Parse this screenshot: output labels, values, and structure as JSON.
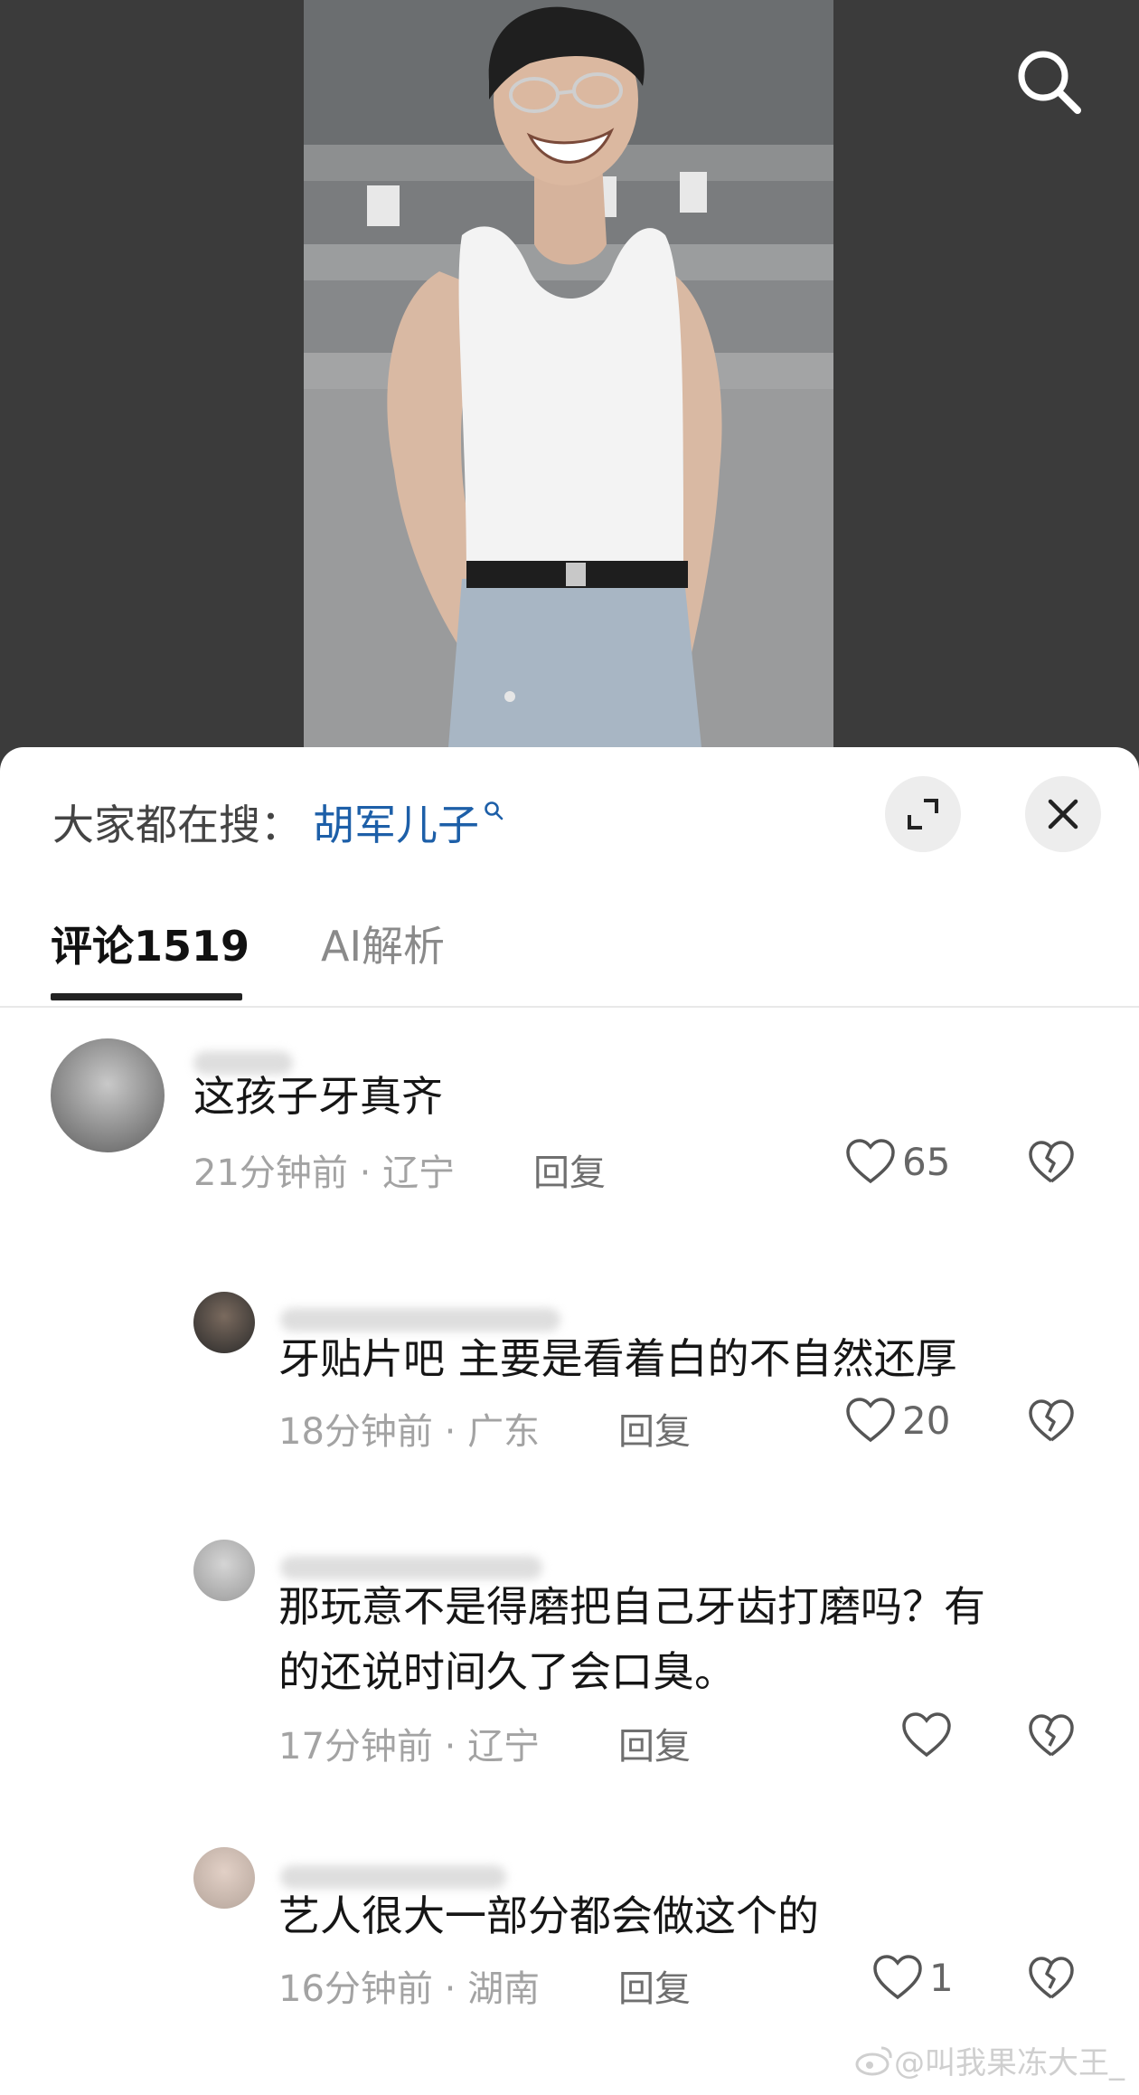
{
  "video": {
    "search_icon": "search-icon"
  },
  "sheet": {
    "hot_search_label": "大家都在搜：",
    "hot_search_term": "胡军儿子",
    "expand_icon": "expand-icon",
    "close_icon": "close-icon"
  },
  "tabs": [
    {
      "label": "评论1519",
      "active": true
    },
    {
      "label": "AI解析",
      "active": false
    }
  ],
  "comments": [
    {
      "text": "这孩子牙真齐",
      "time": "21分钟前",
      "location": "辽宁",
      "reply": "回复",
      "likes": "65"
    },
    {
      "text": "牙贴片吧 主要是看着白的不自然还厚",
      "time": "18分钟前",
      "location": "广东",
      "reply": "回复",
      "likes": "20"
    },
    {
      "text_line1": "那玩意不是得磨把自己牙齿打磨吗？有",
      "text_line2": "的还说时间久了会口臭。",
      "time": "17分钟前",
      "location": "辽宁",
      "reply": "回复",
      "likes": ""
    },
    {
      "text": "艺人很大一部分都会做这个的",
      "time": "16分钟前",
      "location": "湖南",
      "reply": "回复",
      "likes": "1"
    }
  ],
  "meta_separator": " · ",
  "watermark": "@叫我果冻大王_",
  "colors": {
    "accent_link": "#1d5fa8",
    "sheet_bg": "#ffffff",
    "video_bg": "#3b3b3b"
  }
}
